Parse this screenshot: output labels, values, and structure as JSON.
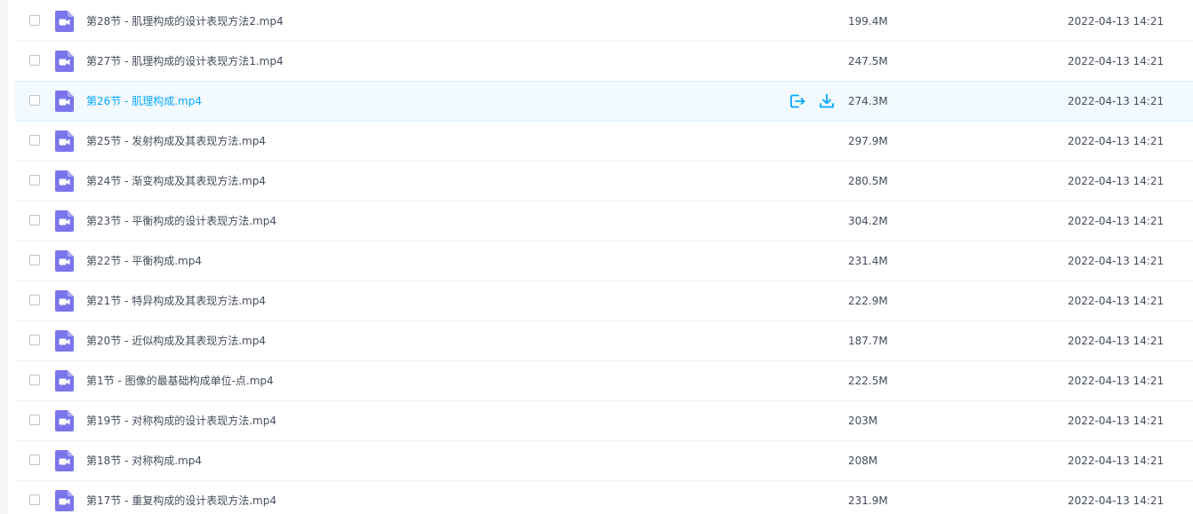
{
  "file_list": {
    "files": [
      {
        "name": "第28节 - 肌理构成的设计表现方法2.mp4",
        "size": "199.4M",
        "modified": "2022-04-13 14:21",
        "icon": "video-file-icon"
      },
      {
        "name": "第27节 - 肌理构成的设计表现方法1.mp4",
        "size": "247.5M",
        "modified": "2022-04-13 14:21",
        "icon": "video-file-icon"
      },
      {
        "name": "第26节 - 肌理构成.mp4",
        "size": "274.3M",
        "modified": "2022-04-13 14:21",
        "icon": "video-file-icon",
        "hovered": true
      },
      {
        "name": "第25节 - 发射构成及其表现方法.mp4",
        "size": "297.9M",
        "modified": "2022-04-13 14:21",
        "icon": "video-file-icon"
      },
      {
        "name": "第24节 - 渐变构成及其表现方法.mp4",
        "size": "280.5M",
        "modified": "2022-04-13 14:21",
        "icon": "video-file-icon"
      },
      {
        "name": "第23节 - 平衡构成的设计表现方法.mp4",
        "size": "304.2M",
        "modified": "2022-04-13 14:21",
        "icon": "video-file-icon"
      },
      {
        "name": "第22节 - 平衡构成.mp4",
        "size": "231.4M",
        "modified": "2022-04-13 14:21",
        "icon": "video-file-icon"
      },
      {
        "name": "第21节 - 特异构成及其表现方法.mp4",
        "size": "222.9M",
        "modified": "2022-04-13 14:21",
        "icon": "video-file-icon"
      },
      {
        "name": "第20节 - 近似构成及其表现方法.mp4",
        "size": "187.7M",
        "modified": "2022-04-13 14:21",
        "icon": "video-file-icon"
      },
      {
        "name": "第1节 - 图像的最基础构成单位-点.mp4",
        "size": "222.5M",
        "modified": "2022-04-13 14:21",
        "icon": "video-file-icon"
      },
      {
        "name": "第19节 - 对称构成的设计表现方法.mp4",
        "size": "203M",
        "modified": "2022-04-13 14:21",
        "icon": "video-file-icon"
      },
      {
        "name": "第18节 - 对称构成.mp4",
        "size": "208M",
        "modified": "2022-04-13 14:21",
        "icon": "video-file-icon"
      },
      {
        "name": "第17节 - 重复构成的设计表现方法.mp4",
        "size": "231.9M",
        "modified": "2022-04-13 14:21",
        "icon": "video-file-icon"
      }
    ],
    "hover_actions": [
      {
        "icon": "share-icon"
      },
      {
        "icon": "download-icon"
      }
    ]
  },
  "colors": {
    "accent": "#06a7ff",
    "text": "#454d5a",
    "video_icon": "#7b75ec",
    "hover_row_bg": "#f2faff"
  }
}
